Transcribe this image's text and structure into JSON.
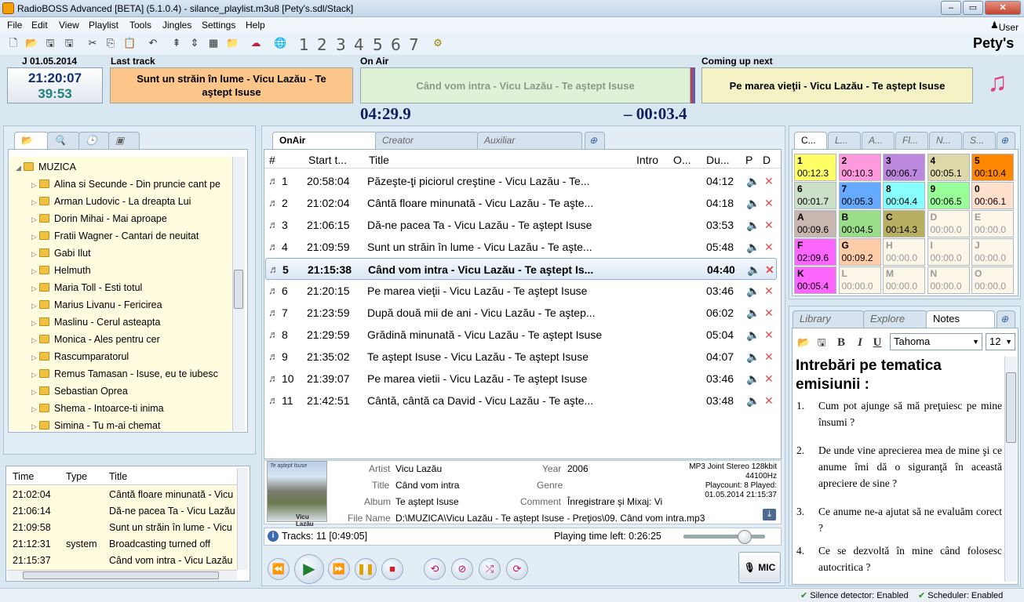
{
  "window": {
    "title": "RadioBOSS Advanced [BETA] (5.1.0.4) - silance_playlist.m3u8 [Pety's.sdl/Stack]",
    "user": "User",
    "station": "Pety's"
  },
  "menu": [
    "File",
    "Edit",
    "View",
    "Playlist",
    "Tools",
    "Jingles",
    "Settings",
    "Help"
  ],
  "toolbar_numbers": [
    "1",
    "2",
    "3",
    "4",
    "5",
    "6",
    "7"
  ],
  "clock": {
    "date": "J 01.05.2014",
    "time": "21:20:07",
    "secondary": "39:53"
  },
  "last_track": {
    "label": "Last track",
    "text": "Sunt un străin în lume - Vicu Lazău - Te aştept Isuse"
  },
  "on_air": {
    "label": "On Air",
    "text": "Când vom intra - Vicu Lazău - Te aştept Isuse",
    "elapsed": "04:29.9",
    "remaining": "– 00:03.4"
  },
  "coming_up": {
    "label": "Coming up next",
    "text": "Pe marea vieţii - Vicu Lazău - Te aştept Isuse"
  },
  "tree": {
    "root": "MUZICA",
    "items": [
      "Alina si Secunde - Din pruncie cant pe",
      "Arman Ludovic - La dreapta Lui",
      "Dorin Mihai - Mai aproape",
      "Fratii Wagner - Cantari de neuitat",
      "Gabi Ilut",
      "Helmuth",
      "Maria Toll - Esti totul",
      "Marius Livanu - Fericirea",
      "Maslinu - Cerul asteapta",
      "Monica - Ales pentru cer",
      "Rascumparatorul",
      "Remus Tamasan - Isuse, eu te iubesc",
      "Sebastian Oprea",
      "Shema - Intoarce-ti inima",
      "Simina - Tu m-ai chemat"
    ]
  },
  "log": {
    "headers": [
      "Time",
      "Type",
      "Title"
    ],
    "rows": [
      {
        "time": "21:02:04",
        "type": "",
        "title": "Cântă floare minunată - Vicu"
      },
      {
        "time": "21:06:14",
        "type": "",
        "title": "Dă-ne pacea Ta - Vicu Lazău"
      },
      {
        "time": "21:09:58",
        "type": "",
        "title": "Sunt un străin în lume - Vicu"
      },
      {
        "time": "21:12:31",
        "type": "system",
        "title": "Broadcasting turned off"
      },
      {
        "time": "21:15:37",
        "type": "",
        "title": "Când vom intra - Vicu Lazău"
      }
    ]
  },
  "playlist_tabs": [
    "OnAir",
    "Creator",
    "Auxiliar"
  ],
  "playlist": {
    "headers": [
      "#",
      "Start t...",
      "Title",
      "Intro",
      "O...",
      "Du...",
      "P",
      "D"
    ],
    "rows": [
      {
        "n": "1",
        "start": "20:58:04",
        "title": "Păzeşte-ţi piciorul creştine - Vicu Lazău - Te...",
        "dur": "04:12"
      },
      {
        "n": "2",
        "start": "21:02:04",
        "title": "Cântă floare minunată - Vicu Lazău - Te aşte...",
        "dur": "04:18"
      },
      {
        "n": "3",
        "start": "21:06:15",
        "title": "Dă-ne pacea Ta - Vicu Lazău - Te aştept Isuse",
        "dur": "03:53"
      },
      {
        "n": "4",
        "start": "21:09:59",
        "title": "Sunt un străin în lume - Vicu Lazău - Te aşte...",
        "dur": "05:48"
      },
      {
        "n": "5",
        "start": "21:15:38",
        "title": "Când vom intra - Vicu Lazău - Te aştept Is...",
        "dur": "04:40"
      },
      {
        "n": "6",
        "start": "21:20:15",
        "title": "Pe marea vieţii - Vicu Lazău - Te aştept Isuse",
        "dur": "03:46"
      },
      {
        "n": "7",
        "start": "21:23:59",
        "title": "După două mii de ani - Vicu Lazău - Te aştep...",
        "dur": "06:02"
      },
      {
        "n": "8",
        "start": "21:29:59",
        "title": "Grădină minunată - Vicu Lazău - Te aştept Isuse",
        "dur": "05:04"
      },
      {
        "n": "9",
        "start": "21:35:02",
        "title": "Te aştept Isuse - Vicu Lazău - Te aştept Isuse",
        "dur": "04:07"
      },
      {
        "n": "10",
        "start": "21:39:07",
        "title": "Pe marea vietii - Vicu Lazău - Te aştept Isuse",
        "dur": "03:46"
      },
      {
        "n": "11",
        "start": "21:42:51",
        "title": "Cântă, cântă ca David - Vicu Lazău - Te aşte...",
        "dur": "03:48"
      }
    ]
  },
  "track_info": {
    "cover_title": "Te aştept Isuse",
    "cover_artist": "Vicu Lazău",
    "artist_label": "Artist",
    "artist": "Vicu Lazău",
    "title_label": "Title",
    "title": "Când vom intra",
    "album_label": "Album",
    "album": "Te aştept Isuse",
    "year_label": "Year",
    "year": "2006",
    "genre_label": "Genre",
    "genre": "",
    "comment_label": "Comment",
    "comment": "Înregistrare şi Mixaj: Vi",
    "file_label": "File Name",
    "file": "D:\\MUZICA\\Vicu Lazău - Te aştept Isuse - Preţios\\09. Când vom intra.mp3",
    "format": "MP3 Joint Stereo 128kbit",
    "rate": "44100Hz",
    "playcount": "Playcount: 8  Played:",
    "played": "01.05.2014 21:15:37"
  },
  "tracks_bar": {
    "tracks": "Tracks: 11 [0:49:05]",
    "time_left": "Playing time left: 0:26:25",
    "volume": 0.75
  },
  "mic_label": "MIC",
  "cart_tabs": [
    "C...",
    "L...",
    "A...",
    "Fl...",
    "N...",
    "S..."
  ],
  "carts": [
    {
      "key": "1",
      "time": "00:12.3",
      "color": "#ffff66"
    },
    {
      "key": "2",
      "time": "00:10.3",
      "color": "#ff99dd"
    },
    {
      "key": "3",
      "time": "00:06.7",
      "color": "#bb88dd"
    },
    {
      "key": "4",
      "time": "00:05.1",
      "color": "#ddd8a8"
    },
    {
      "key": "5",
      "time": "00:10.4",
      "color": "#ff8800"
    },
    {
      "key": "6",
      "time": "00:01.7",
      "color": "#cce0c8"
    },
    {
      "key": "7",
      "time": "00:05.3",
      "color": "#66aaff"
    },
    {
      "key": "8",
      "time": "00:04.4",
      "color": "#88ffff"
    },
    {
      "key": "9",
      "time": "00:06.5",
      "color": "#99ff99"
    },
    {
      "key": "0",
      "time": "00:06.1",
      "color": "#ffe0cc"
    },
    {
      "key": "A",
      "time": "00:09.6",
      "color": "#c9b6b0"
    },
    {
      "key": "B",
      "time": "00:04.5",
      "color": "#99dd88"
    },
    {
      "key": "C",
      "time": "00:14.3",
      "color": "#b8b060"
    },
    {
      "key": "D",
      "time": "00:00.0",
      "color": ""
    },
    {
      "key": "E",
      "time": "00:00.0",
      "color": ""
    },
    {
      "key": "F",
      "time": "02:09.6",
      "color": "#ff66ff"
    },
    {
      "key": "G",
      "time": "00:09.2",
      "color": "#ffccaa"
    },
    {
      "key": "H",
      "time": "00:00.0",
      "color": ""
    },
    {
      "key": "I",
      "time": "00:00.0",
      "color": ""
    },
    {
      "key": "J",
      "time": "00:00.0",
      "color": ""
    },
    {
      "key": "K",
      "time": "00:05.4",
      "color": "#ff66ff"
    },
    {
      "key": "L",
      "time": "00:00.0",
      "color": ""
    },
    {
      "key": "M",
      "time": "00:00.0",
      "color": ""
    },
    {
      "key": "N",
      "time": "00:00.0",
      "color": ""
    },
    {
      "key": "O",
      "time": "00:00.0",
      "color": ""
    }
  ],
  "lower_tabs": [
    "Library",
    "Explore",
    "Notes"
  ],
  "notes": {
    "font": "Tahoma",
    "size": "12",
    "heading": "Intrebări pe tematica emisiunii :",
    "items": [
      {
        "n": "1.",
        "t": "Cum pot ajunge să mă preţuiesc pe mine însumi ?"
      },
      {
        "n": "2.",
        "t": "De unde vine aprecierea mea de mine şi ce anume îmi dă o siguranţă în această apreciere de sine ?"
      },
      {
        "n": "3.",
        "t": "Ce anume ne-a ajutat să ne evaluăm corect ?"
      },
      {
        "n": "4.",
        "t": "Ce se dezvoltă în mine când folosesc autocritica ?"
      }
    ]
  },
  "status": {
    "silence": "Silence detector: Enabled",
    "scheduler": "Scheduler: Enabled"
  }
}
